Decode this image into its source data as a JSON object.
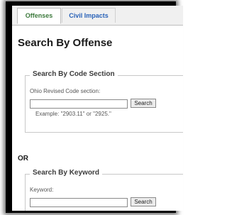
{
  "tabs": [
    {
      "label": "Offenses",
      "active": true
    },
    {
      "label": "Civil Impacts",
      "active": false
    }
  ],
  "page_title": "Search By Offense",
  "code_section": {
    "legend": "Search By Code Section",
    "field_label": "Ohio Revised Code section:",
    "input_value": "",
    "button_label": "Search",
    "example": "Example: \"2903.11\" or \"2925.\""
  },
  "separator": "OR",
  "keyword": {
    "legend": "Search By Keyword",
    "field_label": "Keyword:",
    "input_value": "",
    "button_label": "Search"
  },
  "colors": {
    "active_tab_text": "#3d7a3d",
    "inactive_tab_text": "#2962b8",
    "frame": "#000000"
  }
}
